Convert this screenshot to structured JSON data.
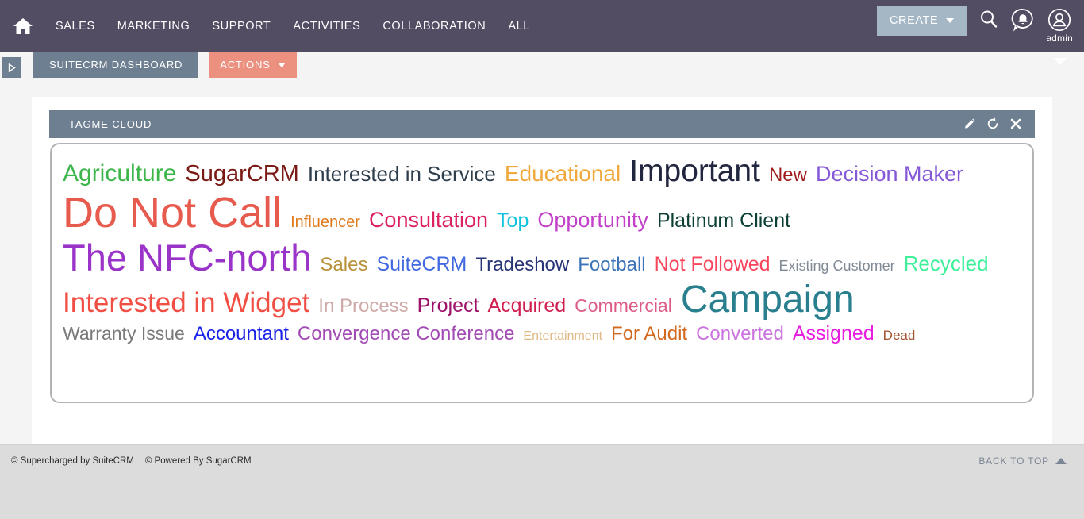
{
  "topnav": {
    "home_icon": "home-icon",
    "links": [
      {
        "label": "SALES"
      },
      {
        "label": "MARKETING"
      },
      {
        "label": "SUPPORT"
      },
      {
        "label": "ACTIVITIES"
      },
      {
        "label": "COLLABORATION"
      },
      {
        "label": "ALL"
      }
    ],
    "create_label": "CREATE",
    "search_icon": "search-icon",
    "notification_icon": "notification-bell-icon",
    "avatar_icon": "user-avatar-icon",
    "user_name": "admin",
    "bg_color": "#534d64",
    "create_bg_color": "#a5b6c4"
  },
  "tabbar": {
    "sidebar_toggle_icon": "expand-sidebar-icon",
    "dashboard_tab_label": "SUITECRM DASHBOARD",
    "actions_tab_label": "ACTIONS",
    "collapse_icon": "chevron-down-icon",
    "dashboard_tab_color": "#6e7f91",
    "actions_tab_color": "#ec9080"
  },
  "dashlet": {
    "title": "TAGME CLOUD",
    "header_color": "#6e7f91",
    "tools": [
      {
        "name": "edit-pencil-icon"
      },
      {
        "name": "refresh-icon"
      },
      {
        "name": "close-icon"
      }
    ],
    "rows": [
      [
        {
          "label": "Agriculture",
          "size": 30,
          "color": "#3cb54a"
        },
        {
          "label": "SugarCRM",
          "size": 29,
          "color": "#7a1a14"
        },
        {
          "label": "Interested in Service",
          "size": 26,
          "color": "#2f3e4d"
        },
        {
          "label": "Educational",
          "size": 28,
          "color": "#f0a93c"
        },
        {
          "label": "Important",
          "size": 39,
          "color": "#22263f"
        },
        {
          "label": "New",
          "size": 24,
          "color": "#9e1b1b"
        },
        {
          "label": "Decision Maker",
          "size": 27,
          "color": "#8458d6"
        }
      ],
      [
        {
          "label": "Do Not Call",
          "size": 54,
          "color": "#e75b4e"
        },
        {
          "label": "Influencer",
          "size": 20,
          "color": "#e07b1e"
        },
        {
          "label": "Consultation",
          "size": 27,
          "color": "#dc2160"
        },
        {
          "label": "Top",
          "size": 25,
          "color": "#13c3dd"
        },
        {
          "label": "Opportunity",
          "size": 27,
          "color": "#c340c9"
        },
        {
          "label": "Platinum Client",
          "size": 25,
          "color": "#0c3f35"
        }
      ],
      [
        {
          "label": "The NFC-north",
          "size": 47,
          "color": "#9a34c9"
        },
        {
          "label": "Sales",
          "size": 24,
          "color": "#b8923a"
        },
        {
          "label": "SuiteCRM",
          "size": 25,
          "color": "#4169e1"
        },
        {
          "label": "Tradeshow",
          "size": 24,
          "color": "#2a3578"
        },
        {
          "label": "Football",
          "size": 24,
          "color": "#3b74b8"
        },
        {
          "label": "Not Followed",
          "size": 25,
          "color": "#f8455c"
        },
        {
          "label": "Existing Customer",
          "size": 18,
          "color": "#7f8a95"
        },
        {
          "label": "Recycled",
          "size": 26,
          "color": "#3ef09a"
        }
      ],
      [
        {
          "label": "Interested in Widget",
          "size": 35,
          "color": "#f14e44"
        },
        {
          "label": "In Process",
          "size": 24,
          "color": "#cdaaa8"
        },
        {
          "label": "Project",
          "size": 25,
          "color": "#9e1169"
        },
        {
          "label": "Acquired",
          "size": 25,
          "color": "#d01e4e"
        },
        {
          "label": "Commercial",
          "size": 23,
          "color": "#dd5c86"
        },
        {
          "label": "Campaign",
          "size": 48,
          "color": "#2a7f8e"
        }
      ],
      [
        {
          "label": "Warranty Issue",
          "size": 23,
          "color": "#7a7a7a"
        },
        {
          "label": "Accountant",
          "size": 24,
          "color": "#1b22e8"
        },
        {
          "label": "Convergence Conference",
          "size": 24,
          "color": "#a34bb5"
        },
        {
          "label": "Entertainment",
          "size": 16,
          "color": "#e0b884"
        },
        {
          "label": "For Audit",
          "size": 24,
          "color": "#d2691e"
        },
        {
          "label": "Converted",
          "size": 24,
          "color": "#cb73de"
        },
        {
          "label": "Assigned",
          "size": 25,
          "color": "#e81be0"
        },
        {
          "label": "Dead",
          "size": 17,
          "color": "#a0522d"
        }
      ]
    ]
  },
  "footer": {
    "supercharged": "© Supercharged by SuiteCRM",
    "powered": "© Powered By SugarCRM",
    "back_to_top": "BACK TO TOP",
    "back_to_top_icon": "triangle-up-icon"
  }
}
